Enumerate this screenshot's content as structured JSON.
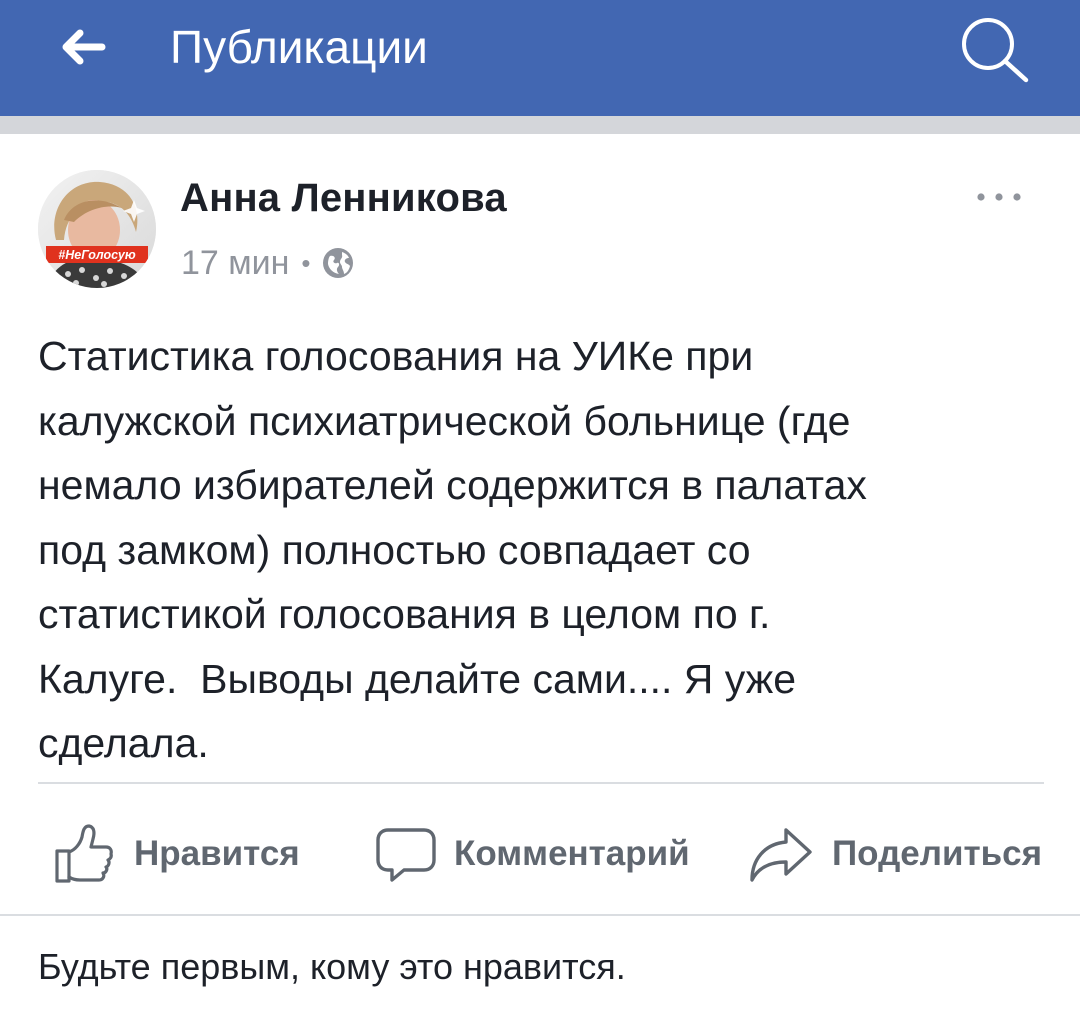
{
  "header": {
    "back_icon": "arrow-left-icon",
    "title": "Публикации",
    "search_icon": "search-icon"
  },
  "post": {
    "author": "Анна Ленникова",
    "avatar_badge": "#НеГолосую",
    "time": "17 мин",
    "separator": "•",
    "privacy_icon": "globe-icon",
    "more_icon": "more-dots-icon",
    "text": "Статистика голосования на УИКе при\nкалужской психиатрической больнице (где\nнемало избирателей содержится в палатах\nпод замком) полностью совпадает со\nстатистикой голосования в целом по г.\nКалуге.  Выводы делайте сами.... Я уже\nсделала.",
    "actions": {
      "like": {
        "label": "Нравится",
        "icon": "thumbs-up-icon"
      },
      "comment": {
        "label": "Комментарий",
        "icon": "comment-icon"
      },
      "share": {
        "label": "Поделиться",
        "icon": "share-icon"
      }
    },
    "likes_summary": "Будьте первым, кому это нравится."
  },
  "colors": {
    "brand": "#4267b2",
    "text": "#1d2129",
    "secondary": "#90949c",
    "action": "#606770",
    "badge": "#e0321e"
  }
}
